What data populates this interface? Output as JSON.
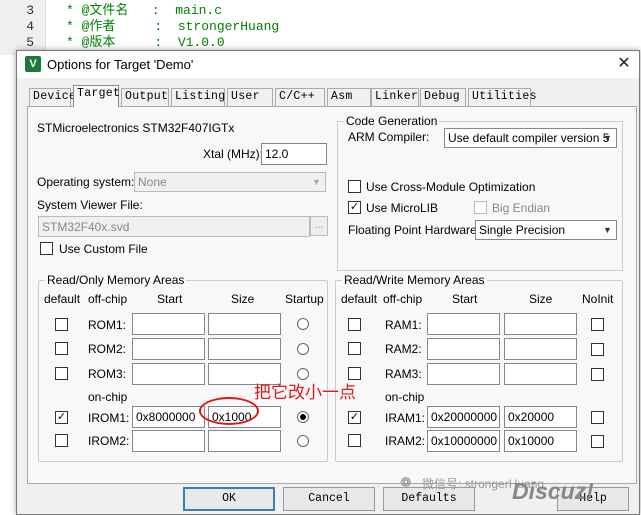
{
  "editor": {
    "lines": [
      {
        "n": "3",
        "text": "* @文件名   :  main.c"
      },
      {
        "n": "4",
        "text": "* @作者     :  strongerHuang"
      },
      {
        "n": "5",
        "text": "* @版本     :  V1.0.0"
      }
    ]
  },
  "dialog": {
    "title": "Options for Target 'Demo'",
    "app_icon_letter": "V",
    "close_glyph": "✕",
    "tabs": [
      "Device",
      "Target",
      "Output",
      "Listing",
      "User",
      "C/C++",
      "Asm",
      "Linker",
      "Debug",
      "Utilities"
    ],
    "active_tab": "Target",
    "device_name": "STMicroelectronics STM32F407IGTx",
    "xtal_label": "Xtal (MHz):",
    "xtal_value": "12.0",
    "os_label": "Operating system:",
    "os_value": "None",
    "sv_label": "System Viewer File:",
    "sv_value": "STM32F40x.svd",
    "browse_glyph": "...",
    "use_custom_file": {
      "label": "Use Custom File",
      "checked": false
    },
    "code_gen": {
      "title": "Code Generation",
      "compiler_label": "ARM Compiler:",
      "compiler_value": "Use default compiler version 5",
      "cross_module": {
        "label": "Use Cross-Module Optimization",
        "checked": false
      },
      "microlib": {
        "label": "Use MicroLIB",
        "checked": true
      },
      "big_endian": {
        "label": "Big Endian",
        "checked": false
      },
      "fp_label": "Floating Point Hardware:",
      "fp_value": "Single Precision"
    },
    "ro_mem": {
      "title": "Read/Only Memory Areas",
      "headers": {
        "default": "default",
        "offchip": "off-chip",
        "start": "Start",
        "size": "Size",
        "startup": "Startup"
      },
      "onchip_label": "on-chip",
      "rows": [
        {
          "label": "ROM1:",
          "start": "",
          "size": "",
          "default": false,
          "startup": false
        },
        {
          "label": "ROM2:",
          "start": "",
          "size": "",
          "default": false,
          "startup": false
        },
        {
          "label": "ROM3:",
          "start": "",
          "size": "",
          "default": false,
          "startup": false
        },
        {
          "label": "IROM1:",
          "start": "0x8000000",
          "size": "0x1000",
          "default": true,
          "startup": true
        },
        {
          "label": "IROM2:",
          "start": "",
          "size": "",
          "default": false,
          "startup": false
        }
      ]
    },
    "rw_mem": {
      "title": "Read/Write Memory Areas",
      "headers": {
        "default": "default",
        "offchip": "off-chip",
        "start": "Start",
        "size": "Size",
        "noinit": "NoInit"
      },
      "onchip_label": "on-chip",
      "rows": [
        {
          "label": "RAM1:",
          "start": "",
          "size": "",
          "default": false,
          "noinit": false
        },
        {
          "label": "RAM2:",
          "start": "",
          "size": "",
          "default": false,
          "noinit": false
        },
        {
          "label": "RAM3:",
          "start": "",
          "size": "",
          "default": false,
          "noinit": false
        },
        {
          "label": "IRAM1:",
          "start": "0x20000000",
          "size": "0x20000",
          "default": true,
          "noinit": false
        },
        {
          "label": "IRAM2:",
          "start": "0x10000000",
          "size": "0x10000",
          "default": false,
          "noinit": false
        }
      ]
    },
    "buttons": {
      "ok": "OK",
      "cancel": "Cancel",
      "defaults": "Defaults",
      "help": "Help"
    }
  },
  "annotation": {
    "text": "把它改小一点",
    "color": "#e01818"
  },
  "watermark": {
    "wechat": "微信号: strongerHuang",
    "brand": "Discuz!"
  }
}
